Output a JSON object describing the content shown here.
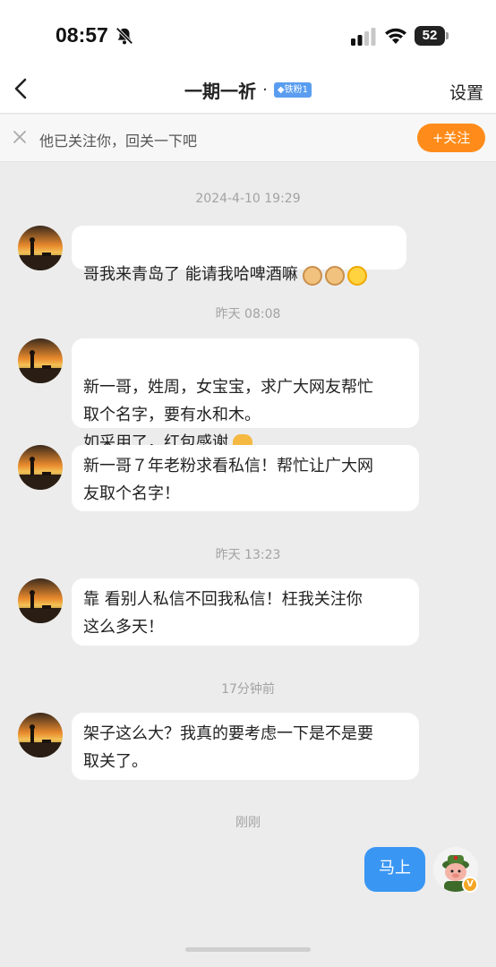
{
  "status_bar": {
    "time": "08:57",
    "battery": "52",
    "icons": [
      "bell-off-icon",
      "signal-icon",
      "wifi-icon",
      "battery-icon"
    ]
  },
  "nav": {
    "title": "一期一祈",
    "dot": "·",
    "fan_badge": "◆铁粉1",
    "settings_label": "设置",
    "back_icon": "chevron-left-icon"
  },
  "follow_banner": {
    "text": "他已关注你，回关一下吧",
    "button_label": "+关注",
    "close_icon": "close-icon"
  },
  "messages": [
    {
      "time": "2024-4-10 19:29"
    },
    {
      "sender": "other",
      "text": "哥我来青岛了 能请我哈啤酒嘛",
      "emoji": [
        "cat-face-icon",
        "cat-face-icon",
        "laughing-face-icon"
      ]
    },
    {
      "time": "昨天 08:08"
    },
    {
      "sender": "other",
      "text": "新一哥，姓周，女宝宝，求广大网友帮忙\n取个名字，要有水和木。\n如采用了，红包感谢",
      "emoji": [
        "praying-hands-icon"
      ]
    },
    {
      "sender": "other",
      "text": "新一哥７年老粉求看私信！帮忙让广大网\n友取个名字！"
    },
    {
      "time": "昨天 13:23"
    },
    {
      "sender": "other",
      "text": "靠 看别人私信不回我私信！枉我关注你\n这么多天！"
    },
    {
      "time": "17分钟前"
    },
    {
      "sender": "other",
      "text": "架子这么大？我真的要考虑一下是不是要\n取关了。"
    },
    {
      "time": "刚刚"
    },
    {
      "sender": "self",
      "text": "马上"
    }
  ],
  "colors": {
    "accent_orange": "#ff8c1a",
    "self_bubble": "#3a96f3",
    "background": "#ececec"
  }
}
